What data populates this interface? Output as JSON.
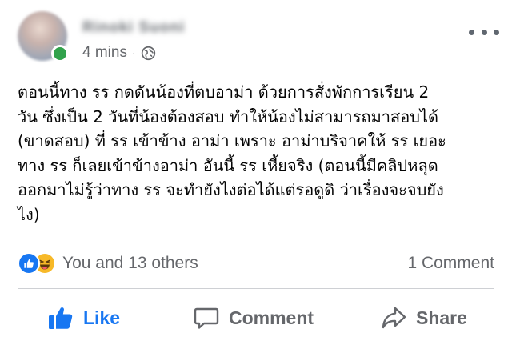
{
  "post": {
    "author_name": "Rinoki Suoni",
    "timestamp": "4 mins",
    "separator": "·",
    "privacy_icon": "globe-icon",
    "text_lines": [
      "ตอนนี้ทาง รร กดดันน้องที่ตบอาม่า ด้วยการสั่งพักการเรียน 2",
      "วัน ซึ่งเป็น 2 วันที่น้องต้องสอบ ทำให้น้องไม่สามารถมาสอบได้",
      "(ขาดสอบ) ที่ รร เข้าข้าง อาม่า เพราะ อาม่าบริจาคให้ รร เยอะ",
      "ทาง รร ก็เลยเข้าข้างอาม่า อันนี้ รร เหี้ยจริง (ตอนนี้มีคลิปหลุด",
      "ออกมาไม่รู้ว่าทาง รร จะทำยังไงต่อได้แต่รอดูดิ ว่าเรื่องจะจบยัง",
      "ไง)"
    ]
  },
  "reactions": {
    "icons": [
      "like-icon",
      "haha-icon"
    ],
    "summary": "You and 13 others",
    "comments": "1 Comment"
  },
  "actions": {
    "like": "Like",
    "comment": "Comment",
    "share": "Share"
  },
  "colors": {
    "accent": "#1877f2",
    "muted": "#65676b",
    "online": "#31a24c",
    "haha": "#f7b928"
  }
}
